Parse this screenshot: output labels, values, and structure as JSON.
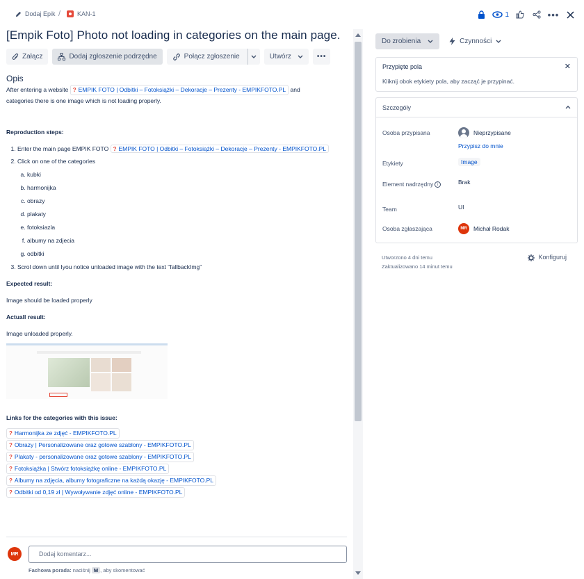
{
  "breadcrumb": {
    "epic_label": "Dodaj Epik",
    "issue_key": "KAN-1"
  },
  "top_actions": {
    "watch_count": "1"
  },
  "issue": {
    "title": "[Empik Foto] Photo not loading in categories on the main page."
  },
  "toolbar": {
    "attach": "Załącz",
    "add_child": "Dodaj zgłoszenie podrzędne",
    "link_issue": "Połącz zgłoszenie",
    "create": "Utwórz"
  },
  "description": {
    "heading": "Opis",
    "intro_before": "After entering a website",
    "intro_link": "EMPIK FOTO | Odbitki – Fotoksiążki – Dekoracje – Prezenty - EMPIKFOTO.PL",
    "intro_after": "and",
    "intro_line2": "categories there is one image which is not loading properly.",
    "repro_heading": "Reproduction steps:",
    "step1_text": "Enter the main page EMPIK FOTO",
    "step1_link": "EMPIK FOTO | Odbitki – Fotoksiążki – Dekoracje – Prezenty - EMPIKFOTO.PL",
    "step2_text": "Click on one of the categories",
    "categories": [
      "kubki",
      "harmonijka",
      "obrazy",
      "plakaty",
      "fotoksiazla",
      "albumy na zdjecia",
      "odbitki"
    ],
    "step3_text": "Scrol down until Iyou notice unloaded image with the text “fallbackImg”",
    "expected_heading": "Expected result:",
    "expected_text": "Image should be loaded properly",
    "actual_heading": "Actuall result:",
    "actual_text": "Image unloaded properly.",
    "links_heading": "Links for the categories with this issue:",
    "links": [
      "Harmonijka ze zdjęć - EMPIKFOTO.PL",
      "Obrazy | Personalizowane oraz gotowe szablony - EMPIKFOTO.PL",
      "Plakaty - personalizowane oraz gotowe szablony - EMPIKFOTO.PL",
      "Fotoksiążka | Stwórz fotoksiążkę online - EMPIKFOTO.PL",
      "Albumy na zdjęcia, albumy fotograficzne na każdą okazję - EMPIKFOTO.PL",
      "Odbitki od 0,19 zł | Wywoływanie zdjęć online - EMPIKFOTO.PL"
    ]
  },
  "comment": {
    "avatar": "MR",
    "placeholder": "Dodaj komentarz...",
    "tip_bold": "Fachowa porada:",
    "tip_before": "naciśnij",
    "tip_key": "M",
    "tip_after": ", aby skomentować"
  },
  "sidebar": {
    "status": "Do zrobienia",
    "actions": "Czynności",
    "pinned": {
      "title": "Przypięte pola",
      "text": "Kliknij  obok etykiety pola, aby zacząć je przypinać."
    },
    "details": {
      "title": "Szczegóły",
      "assignee_label": "Osoba przypisana",
      "assignee_value": "Nieprzypisane",
      "assign_me": "Przypisz do mnie",
      "labels_label": "Etykiety",
      "labels_value": "Image",
      "parent_label": "Element nadrzędny",
      "parent_value": "Brak",
      "team_label": "Team",
      "team_value": "UI",
      "reporter_label": "Osoba zgłaszająca",
      "reporter_avatar": "MR",
      "reporter_value": "Michał Rodak"
    },
    "created": "Utworzono 4 dni temu",
    "updated": "Zaktualizowano 14 minut temu",
    "configure": "Konfiguruj"
  },
  "colors": {
    "link": "#0052cc",
    "avatar": "#de350b",
    "favicon": "#e5493a"
  }
}
